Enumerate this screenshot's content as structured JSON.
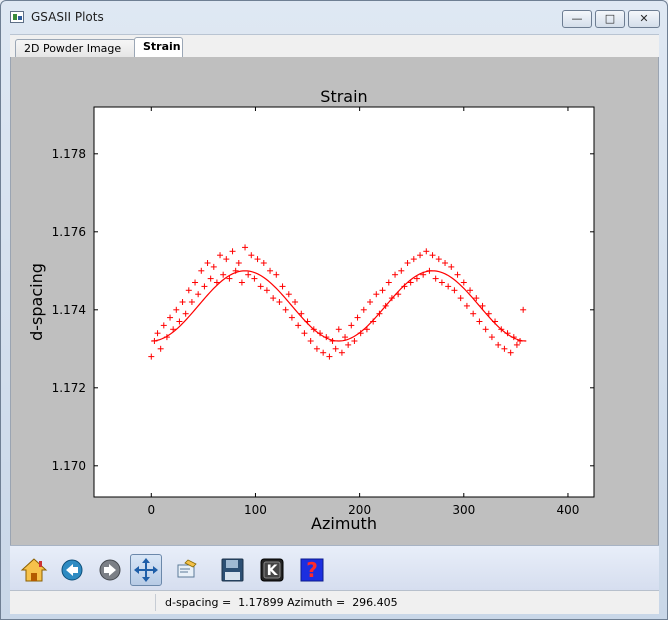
{
  "window": {
    "title": "GSASII Plots",
    "minimize": "—",
    "maximize": "□",
    "close": "✕"
  },
  "tabs": [
    {
      "label": "2D Powder Image"
    },
    {
      "label": "Strain"
    }
  ],
  "plot": {
    "title": "Strain",
    "xlabel": "Azimuth",
    "ylabel": "d-spacing"
  },
  "chart_data": {
    "type": "scatter",
    "title": "Strain",
    "xlabel": "Azimuth",
    "ylabel": "d-spacing",
    "xlim": [
      -55,
      425
    ],
    "ylim": [
      1.1692,
      1.1792
    ],
    "xticks": [
      0,
      100,
      200,
      300,
      400
    ],
    "yticks": [
      1.17,
      1.172,
      1.174,
      1.176,
      1.178
    ],
    "xtick_labels": [
      "0",
      "100",
      "200",
      "300",
      "400"
    ],
    "ytick_labels": [
      "1.170",
      "1.172",
      "1.174",
      "1.176",
      "1.178"
    ],
    "marker": "+",
    "color": "#ff0000",
    "fit_curve": {
      "mean": 1.1741,
      "amplitude": 0.0009,
      "period": 180,
      "phase_deg": 0
    },
    "points": {
      "x": [
        0,
        3,
        6,
        9,
        12,
        15,
        18,
        21,
        24,
        27,
        30,
        33,
        36,
        39,
        42,
        45,
        48,
        51,
        54,
        57,
        60,
        63,
        66,
        69,
        72,
        75,
        78,
        81,
        84,
        87,
        90,
        93,
        96,
        99,
        102,
        105,
        108,
        111,
        114,
        117,
        120,
        123,
        126,
        129,
        132,
        135,
        138,
        141,
        144,
        147,
        150,
        153,
        156,
        159,
        162,
        165,
        168,
        171,
        174,
        177,
        180,
        183,
        186,
        189,
        192,
        195,
        198,
        201,
        204,
        207,
        210,
        213,
        216,
        219,
        222,
        225,
        228,
        231,
        234,
        237,
        240,
        243,
        246,
        249,
        252,
        255,
        258,
        261,
        264,
        267,
        270,
        273,
        276,
        279,
        282,
        285,
        288,
        291,
        294,
        297,
        300,
        303,
        306,
        309,
        312,
        315,
        318,
        321,
        324,
        327,
        330,
        333,
        336,
        339,
        342,
        345,
        348,
        351,
        354,
        357
      ],
      "y": [
        1.1728,
        1.1732,
        1.1734,
        1.173,
        1.1736,
        1.1733,
        1.1738,
        1.1735,
        1.174,
        1.1737,
        1.1742,
        1.1739,
        1.1745,
        1.1742,
        1.1747,
        1.1744,
        1.175,
        1.1746,
        1.1752,
        1.1748,
        1.1751,
        1.1747,
        1.1754,
        1.1749,
        1.1753,
        1.1748,
        1.1755,
        1.175,
        1.1752,
        1.1747,
        1.1756,
        1.1749,
        1.1754,
        1.1748,
        1.1753,
        1.1746,
        1.1752,
        1.1745,
        1.175,
        1.1743,
        1.1749,
        1.1742,
        1.1746,
        1.174,
        1.1744,
        1.1738,
        1.1742,
        1.1736,
        1.1739,
        1.1734,
        1.1737,
        1.1732,
        1.1735,
        1.173,
        1.1734,
        1.1729,
        1.1733,
        1.1728,
        1.1732,
        1.173,
        1.1735,
        1.1729,
        1.1733,
        1.1731,
        1.1736,
        1.1732,
        1.1738,
        1.1734,
        1.174,
        1.1735,
        1.1742,
        1.1737,
        1.1744,
        1.1739,
        1.1745,
        1.1741,
        1.1747,
        1.1743,
        1.1749,
        1.1744,
        1.175,
        1.1746,
        1.1752,
        1.1747,
        1.1753,
        1.1748,
        1.1754,
        1.1749,
        1.1755,
        1.175,
        1.1754,
        1.1748,
        1.1753,
        1.1747,
        1.1752,
        1.1746,
        1.1751,
        1.1745,
        1.1749,
        1.1743,
        1.1747,
        1.1741,
        1.1745,
        1.1739,
        1.1743,
        1.1737,
        1.1741,
        1.1735,
        1.1739,
        1.1733,
        1.1737,
        1.1731,
        1.1735,
        1.173,
        1.1734,
        1.1729,
        1.1733,
        1.1731,
        1.1732,
        1.174
      ]
    }
  },
  "toolbar": {
    "home": "Home",
    "back": "Back",
    "forward": "Forward",
    "pan": "Pan",
    "edit": "Edit",
    "save": "Save",
    "k": "K",
    "help": "?"
  },
  "status": {
    "text": "d-spacing =  1.17899 Azimuth =  296.405"
  }
}
